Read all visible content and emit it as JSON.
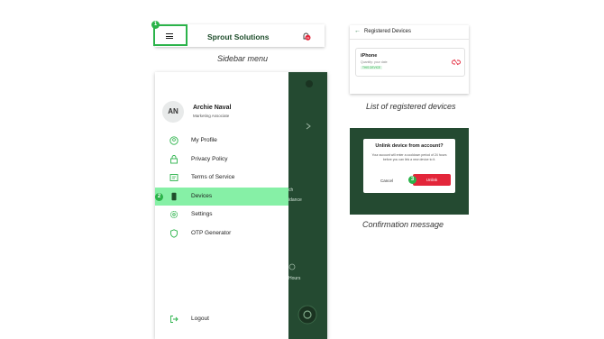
{
  "topbar": {
    "brand": "Sprout Solutions",
    "step_badge": "1",
    "notification_count": "19",
    "caption": "Sidebar menu"
  },
  "sidebar": {
    "avatar_initials": "AN",
    "user_name": "Archie Naval",
    "user_role": "Marketing Associate",
    "items": [
      {
        "label": "My Profile",
        "icon": "user-circle-icon"
      },
      {
        "label": "Privacy Policy",
        "icon": "lock-icon"
      },
      {
        "label": "Terms of Service",
        "icon": "document-icon"
      },
      {
        "label": "Devices",
        "icon": "phone-icon",
        "active": true
      },
      {
        "label": "Settings",
        "icon": "gear-icon"
      },
      {
        "label": "OTP Generator",
        "icon": "shield-icon"
      }
    ],
    "logout_label": "Logout",
    "step_badge": "2",
    "background_text": {
      "a": "ch",
      "b": "idance",
      "c": "Hours"
    }
  },
  "registered": {
    "title": "Registered Devices",
    "device_name": "iPhone",
    "device_sub": "Quantity: your date",
    "device_tag": "THIS DEVICE",
    "caption": "List of registered devices"
  },
  "confirmation": {
    "title": "Unlink device from account?",
    "body": "Your account will enter a cooldown period of 24 hours before you can link a new device to it.",
    "cancel_label": "Cancel",
    "unlink_label": "Unlink",
    "step_badge": "3",
    "caption": "Confirmation message"
  },
  "colors": {
    "accent": "#2bb34a",
    "dark_green": "#244a31",
    "active_item": "#86f0a6",
    "danger": "#e3263a"
  }
}
